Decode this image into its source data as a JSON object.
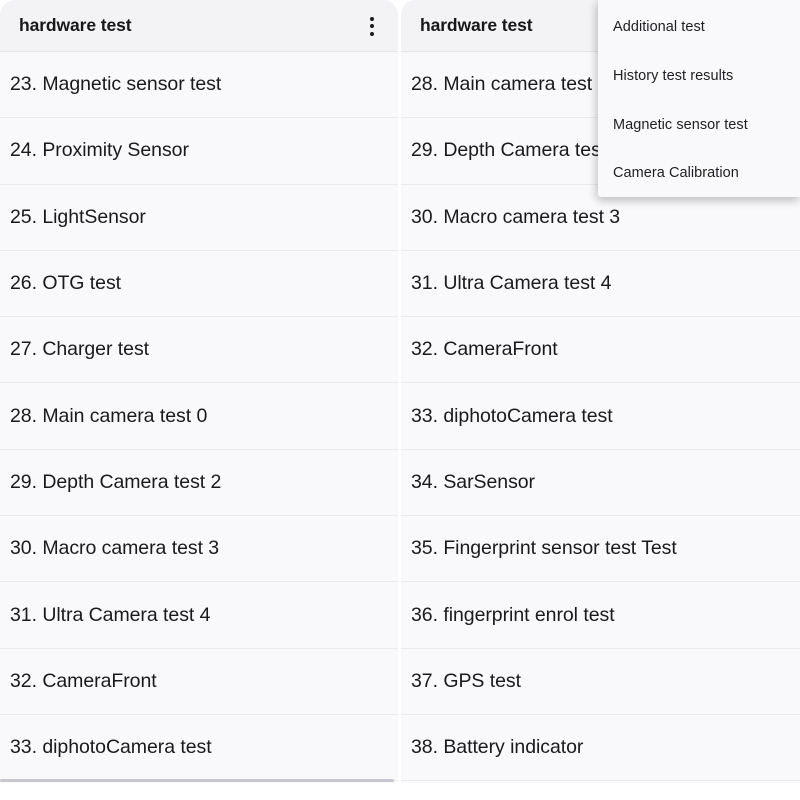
{
  "left_panel": {
    "appbar": {
      "title": "hardware test",
      "overflow_icon": "more-vertical-icon"
    },
    "items": [
      {
        "label": "23. Magnetic sensor test"
      },
      {
        "label": "24. Proximity Sensor"
      },
      {
        "label": "25. LightSensor"
      },
      {
        "label": "26. OTG test"
      },
      {
        "label": "27. Charger test"
      },
      {
        "label": "28. Main camera test 0"
      },
      {
        "label": "29. Depth Camera test 2"
      },
      {
        "label": "30. Macro camera test 3"
      },
      {
        "label": "31. Ultra Camera test 4"
      },
      {
        "label": "32. CameraFront"
      },
      {
        "label": "33. diphotoCamera test"
      }
    ]
  },
  "right_panel": {
    "appbar": {
      "title": "hardware test",
      "overflow_icon": "more-vertical-icon"
    },
    "items": [
      {
        "label": "28. Main camera test 0"
      },
      {
        "label": "29. Depth Camera test 2"
      },
      {
        "label": "30. Macro camera test 3"
      },
      {
        "label": "31. Ultra Camera test 4"
      },
      {
        "label": "32. CameraFront"
      },
      {
        "label": "33. diphotoCamera test"
      },
      {
        "label": "34. SarSensor"
      },
      {
        "label": "35. Fingerprint sensor test Test"
      },
      {
        "label": "36. fingerprint enrol test"
      },
      {
        "label": "37. GPS test"
      },
      {
        "label": "38. Battery indicator"
      }
    ]
  },
  "popup_menu": {
    "items": [
      {
        "label": "Additional test"
      },
      {
        "label": "History test results"
      },
      {
        "label": "Magnetic sensor test"
      },
      {
        "label": "Camera Calibration"
      }
    ]
  },
  "colors": {
    "appbar_bg": "#f3f2f5",
    "list_bg": "#f9f8fa",
    "divider": "#ebe9ee",
    "text_primary": "#1a191c",
    "page_bg": "#ffffff",
    "scrollbar_thumb": "#c9c6ce"
  }
}
